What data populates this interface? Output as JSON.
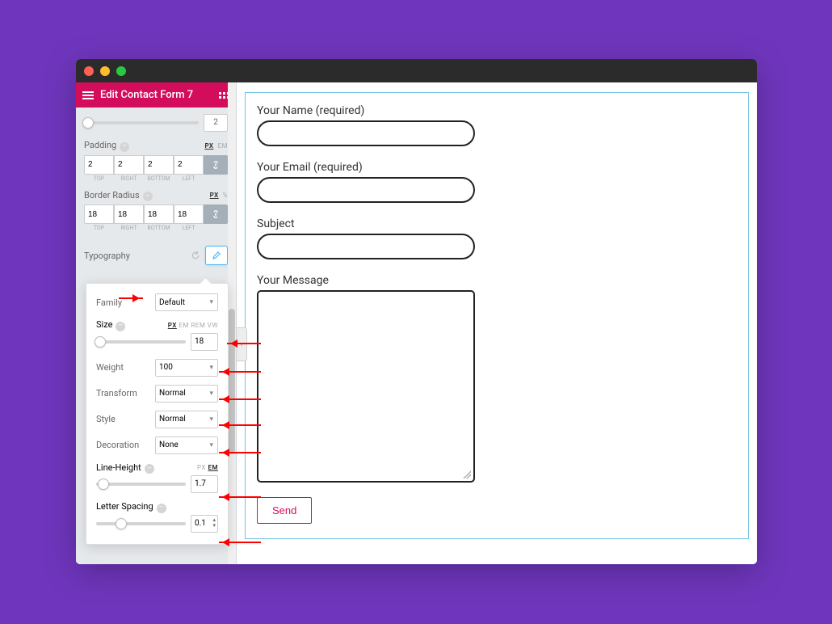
{
  "header": {
    "title": "Edit Contact Form 7"
  },
  "sidebar": {
    "gap_value": "2",
    "padding": {
      "label": "Padding",
      "units": "PX",
      "unit_em": "EM",
      "top": "2",
      "right": "2",
      "bottom": "2",
      "left": "2",
      "l_top": "TOP",
      "l_right": "RIGHT",
      "l_bottom": "BOTTOM",
      "l_left": "LEFT"
    },
    "radius": {
      "label": "Border Radius",
      "units": "PX",
      "unit_pct": "%",
      "top": "18",
      "right": "18",
      "bottom": "18",
      "left": "18",
      "l_top": "TOP",
      "l_right": "RIGHT",
      "l_bottom": "BOTTOM",
      "l_left": "LEFT"
    },
    "typography": {
      "label": "Typography"
    }
  },
  "popover": {
    "family": {
      "label": "Family",
      "value": "Default"
    },
    "size": {
      "label": "Size",
      "units": "PX",
      "u_em": "EM",
      "u_rem": "REM",
      "u_vw": "VW",
      "value": "18"
    },
    "weight": {
      "label": "Weight",
      "value": "100"
    },
    "transform": {
      "label": "Transform",
      "value": "Normal"
    },
    "style": {
      "label": "Style",
      "value": "Normal"
    },
    "decoration": {
      "label": "Decoration",
      "value": "None"
    },
    "lineheight": {
      "label": "Line-Height",
      "units": "PX",
      "u_em": "EM",
      "value": "1.7"
    },
    "letterspacing": {
      "label": "Letter Spacing",
      "value": "0.1"
    }
  },
  "form": {
    "name_label": "Your Name (required)",
    "email_label": "Your Email (required)",
    "subject_label": "Subject",
    "message_label": "Your Message",
    "send": "Send"
  }
}
